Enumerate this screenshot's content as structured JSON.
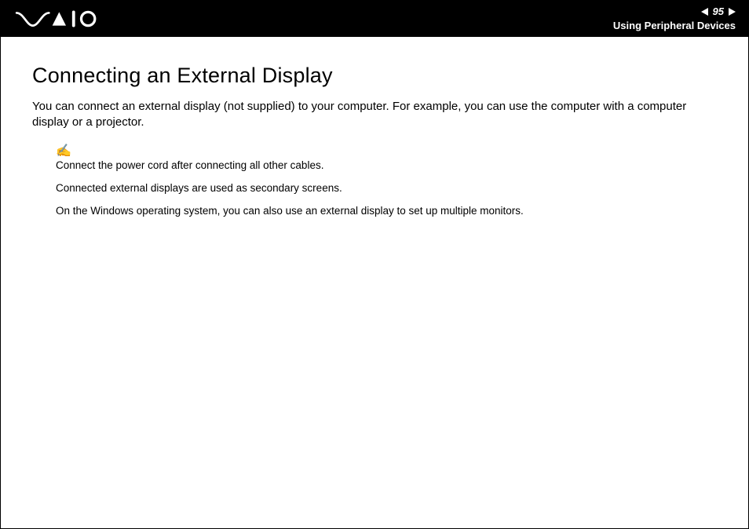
{
  "header": {
    "page_number": "95",
    "breadcrumb": "Using Peripheral Devices"
  },
  "main": {
    "title": "Connecting an External Display",
    "intro": "You can connect an external display (not supplied) to your computer. For example, you can use the computer with a computer display or a projector.",
    "notes": [
      "Connect the power cord after connecting all other cables.",
      "Connected external displays are used as secondary screens.",
      "On the Windows operating system, you can also use an external display to set up multiple monitors."
    ]
  }
}
